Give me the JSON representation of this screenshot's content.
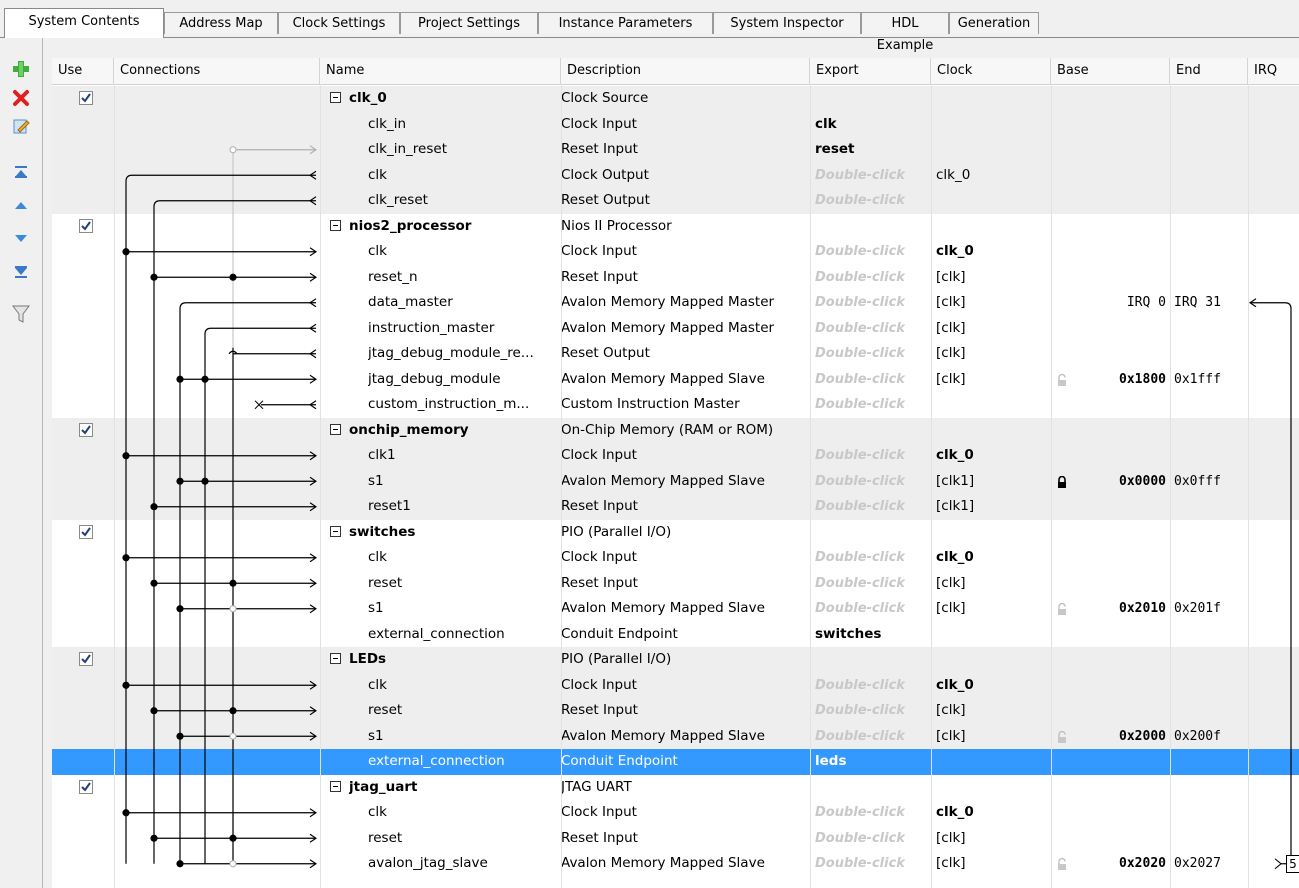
{
  "tabs": [
    "System Contents",
    "Address Map",
    "Clock Settings",
    "Project Settings",
    "Instance Parameters",
    "System Inspector",
    "HDL Example",
    "Generation"
  ],
  "toolbar_icons": [
    "add-icon",
    "remove-icon",
    "edit-icon",
    "move-top-icon",
    "move-up-icon",
    "move-down-icon",
    "move-bottom-icon",
    "filter-icon"
  ],
  "columns": {
    "use": "Use",
    "connections": "Connections",
    "name": "Name",
    "description": "Description",
    "export": "Export",
    "clock": "Clock",
    "base": "Base",
    "end": "End",
    "irq": "IRQ"
  },
  "colors": {
    "selection": "#3399ff",
    "alt_row": "#eeeeee",
    "double_click": "#c8c8c8"
  },
  "rows": [
    {
      "kind": "component",
      "name": "clk_0",
      "description": "Clock Source",
      "export": "",
      "clock": "",
      "base": "",
      "end": "",
      "checked": true
    },
    {
      "kind": "iface",
      "name": "clk_in",
      "description": "Clock Input",
      "export": "clk",
      "clock": "",
      "base": "",
      "end": ""
    },
    {
      "kind": "iface",
      "name": "clk_in_reset",
      "description": "Reset Input",
      "export": "reset",
      "clock": "",
      "base": "",
      "end": ""
    },
    {
      "kind": "iface",
      "name": "clk",
      "description": "Clock Output",
      "export": "Double-click",
      "clock": "clk_0",
      "base": "",
      "end": ""
    },
    {
      "kind": "iface",
      "name": "clk_reset",
      "description": "Reset Output",
      "export": "Double-click",
      "clock": "",
      "base": "",
      "end": ""
    },
    {
      "kind": "component",
      "name": "nios2_processor",
      "description": "Nios II Processor",
      "export": "",
      "clock": "",
      "base": "",
      "end": "",
      "checked": true
    },
    {
      "kind": "iface",
      "name": "clk",
      "description": "Clock Input",
      "export": "Double-click",
      "clock": "clk_0",
      "clock_bold": true,
      "base": "",
      "end": ""
    },
    {
      "kind": "iface",
      "name": "reset_n",
      "description": "Reset Input",
      "export": "Double-click",
      "clock": "[clk]",
      "base": "",
      "end": ""
    },
    {
      "kind": "iface",
      "name": "data_master",
      "description": "Avalon Memory Mapped Master",
      "export": "Double-click",
      "clock": "[clk]",
      "base": "IRQ 0",
      "end": "IRQ 31"
    },
    {
      "kind": "iface",
      "name": "instruction_master",
      "description": "Avalon Memory Mapped Master",
      "export": "Double-click",
      "clock": "[clk]",
      "base": "",
      "end": ""
    },
    {
      "kind": "iface",
      "name": "jtag_debug_module_re...",
      "description": "Reset Output",
      "export": "Double-click",
      "clock": "[clk]",
      "base": "",
      "end": ""
    },
    {
      "kind": "iface",
      "name": "jtag_debug_module",
      "description": "Avalon Memory Mapped Slave",
      "export": "Double-click",
      "clock": "[clk]",
      "base": "0x1800",
      "end": "0x1fff",
      "lock": "open"
    },
    {
      "kind": "iface",
      "name": "custom_instruction_m...",
      "description": "Custom Instruction Master",
      "export": "Double-click",
      "clock": "",
      "base": "",
      "end": ""
    },
    {
      "kind": "component",
      "name": "onchip_memory",
      "description": "On-Chip Memory (RAM or ROM)",
      "export": "",
      "clock": "",
      "base": "",
      "end": "",
      "checked": true
    },
    {
      "kind": "iface",
      "name": "clk1",
      "description": "Clock Input",
      "export": "Double-click",
      "clock": "clk_0",
      "clock_bold": true,
      "base": "",
      "end": ""
    },
    {
      "kind": "iface",
      "name": "s1",
      "description": "Avalon Memory Mapped Slave",
      "export": "Double-click",
      "clock": "[clk1]",
      "base": "0x0000",
      "end": "0x0fff",
      "lock": "closed"
    },
    {
      "kind": "iface",
      "name": "reset1",
      "description": "Reset Input",
      "export": "Double-click",
      "clock": "[clk1]",
      "base": "",
      "end": ""
    },
    {
      "kind": "component",
      "name": "switches",
      "description": "PIO (Parallel I/O)",
      "export": "",
      "clock": "",
      "base": "",
      "end": "",
      "checked": true
    },
    {
      "kind": "iface",
      "name": "clk",
      "description": "Clock Input",
      "export": "Double-click",
      "clock": "clk_0",
      "clock_bold": true,
      "base": "",
      "end": ""
    },
    {
      "kind": "iface",
      "name": "reset",
      "description": "Reset Input",
      "export": "Double-click",
      "clock": "[clk]",
      "base": "",
      "end": ""
    },
    {
      "kind": "iface",
      "name": "s1",
      "description": "Avalon Memory Mapped Slave",
      "export": "Double-click",
      "clock": "[clk]",
      "base": "0x2010",
      "end": "0x201f",
      "lock": "open"
    },
    {
      "kind": "iface",
      "name": "external_connection",
      "description": "Conduit Endpoint",
      "export": "switches",
      "clock": "",
      "base": "",
      "end": ""
    },
    {
      "kind": "component",
      "name": "LEDs",
      "description": "PIO (Parallel I/O)",
      "export": "",
      "clock": "",
      "base": "",
      "end": "",
      "checked": true
    },
    {
      "kind": "iface",
      "name": "clk",
      "description": "Clock Input",
      "export": "Double-click",
      "clock": "clk_0",
      "clock_bold": true,
      "base": "",
      "end": ""
    },
    {
      "kind": "iface",
      "name": "reset",
      "description": "Reset Input",
      "export": "Double-click",
      "clock": "[clk]",
      "base": "",
      "end": ""
    },
    {
      "kind": "iface",
      "name": "s1",
      "description": "Avalon Memory Mapped Slave",
      "export": "Double-click",
      "clock": "[clk]",
      "base": "0x2000",
      "end": "0x200f",
      "lock": "open"
    },
    {
      "kind": "iface",
      "name": "external_connection",
      "description": "Conduit Endpoint",
      "export": "leds",
      "clock": "",
      "base": "",
      "end": "",
      "selected": true
    },
    {
      "kind": "component",
      "name": "jtag_uart",
      "description": "JTAG UART",
      "export": "",
      "clock": "",
      "base": "",
      "end": "",
      "checked": true
    },
    {
      "kind": "iface",
      "name": "clk",
      "description": "Clock Input",
      "export": "Double-click",
      "clock": "clk_0",
      "clock_bold": true,
      "base": "",
      "end": ""
    },
    {
      "kind": "iface",
      "name": "reset",
      "description": "Reset Input",
      "export": "Double-click",
      "clock": "[clk]",
      "base": "",
      "end": ""
    },
    {
      "kind": "iface",
      "name": "avalon_jtag_slave",
      "description": "Avalon Memory Mapped Slave",
      "export": "Double-click",
      "clock": "[clk]",
      "base": "0x2020",
      "end": "0x2027",
      "lock": "open",
      "irq": "5"
    }
  ]
}
